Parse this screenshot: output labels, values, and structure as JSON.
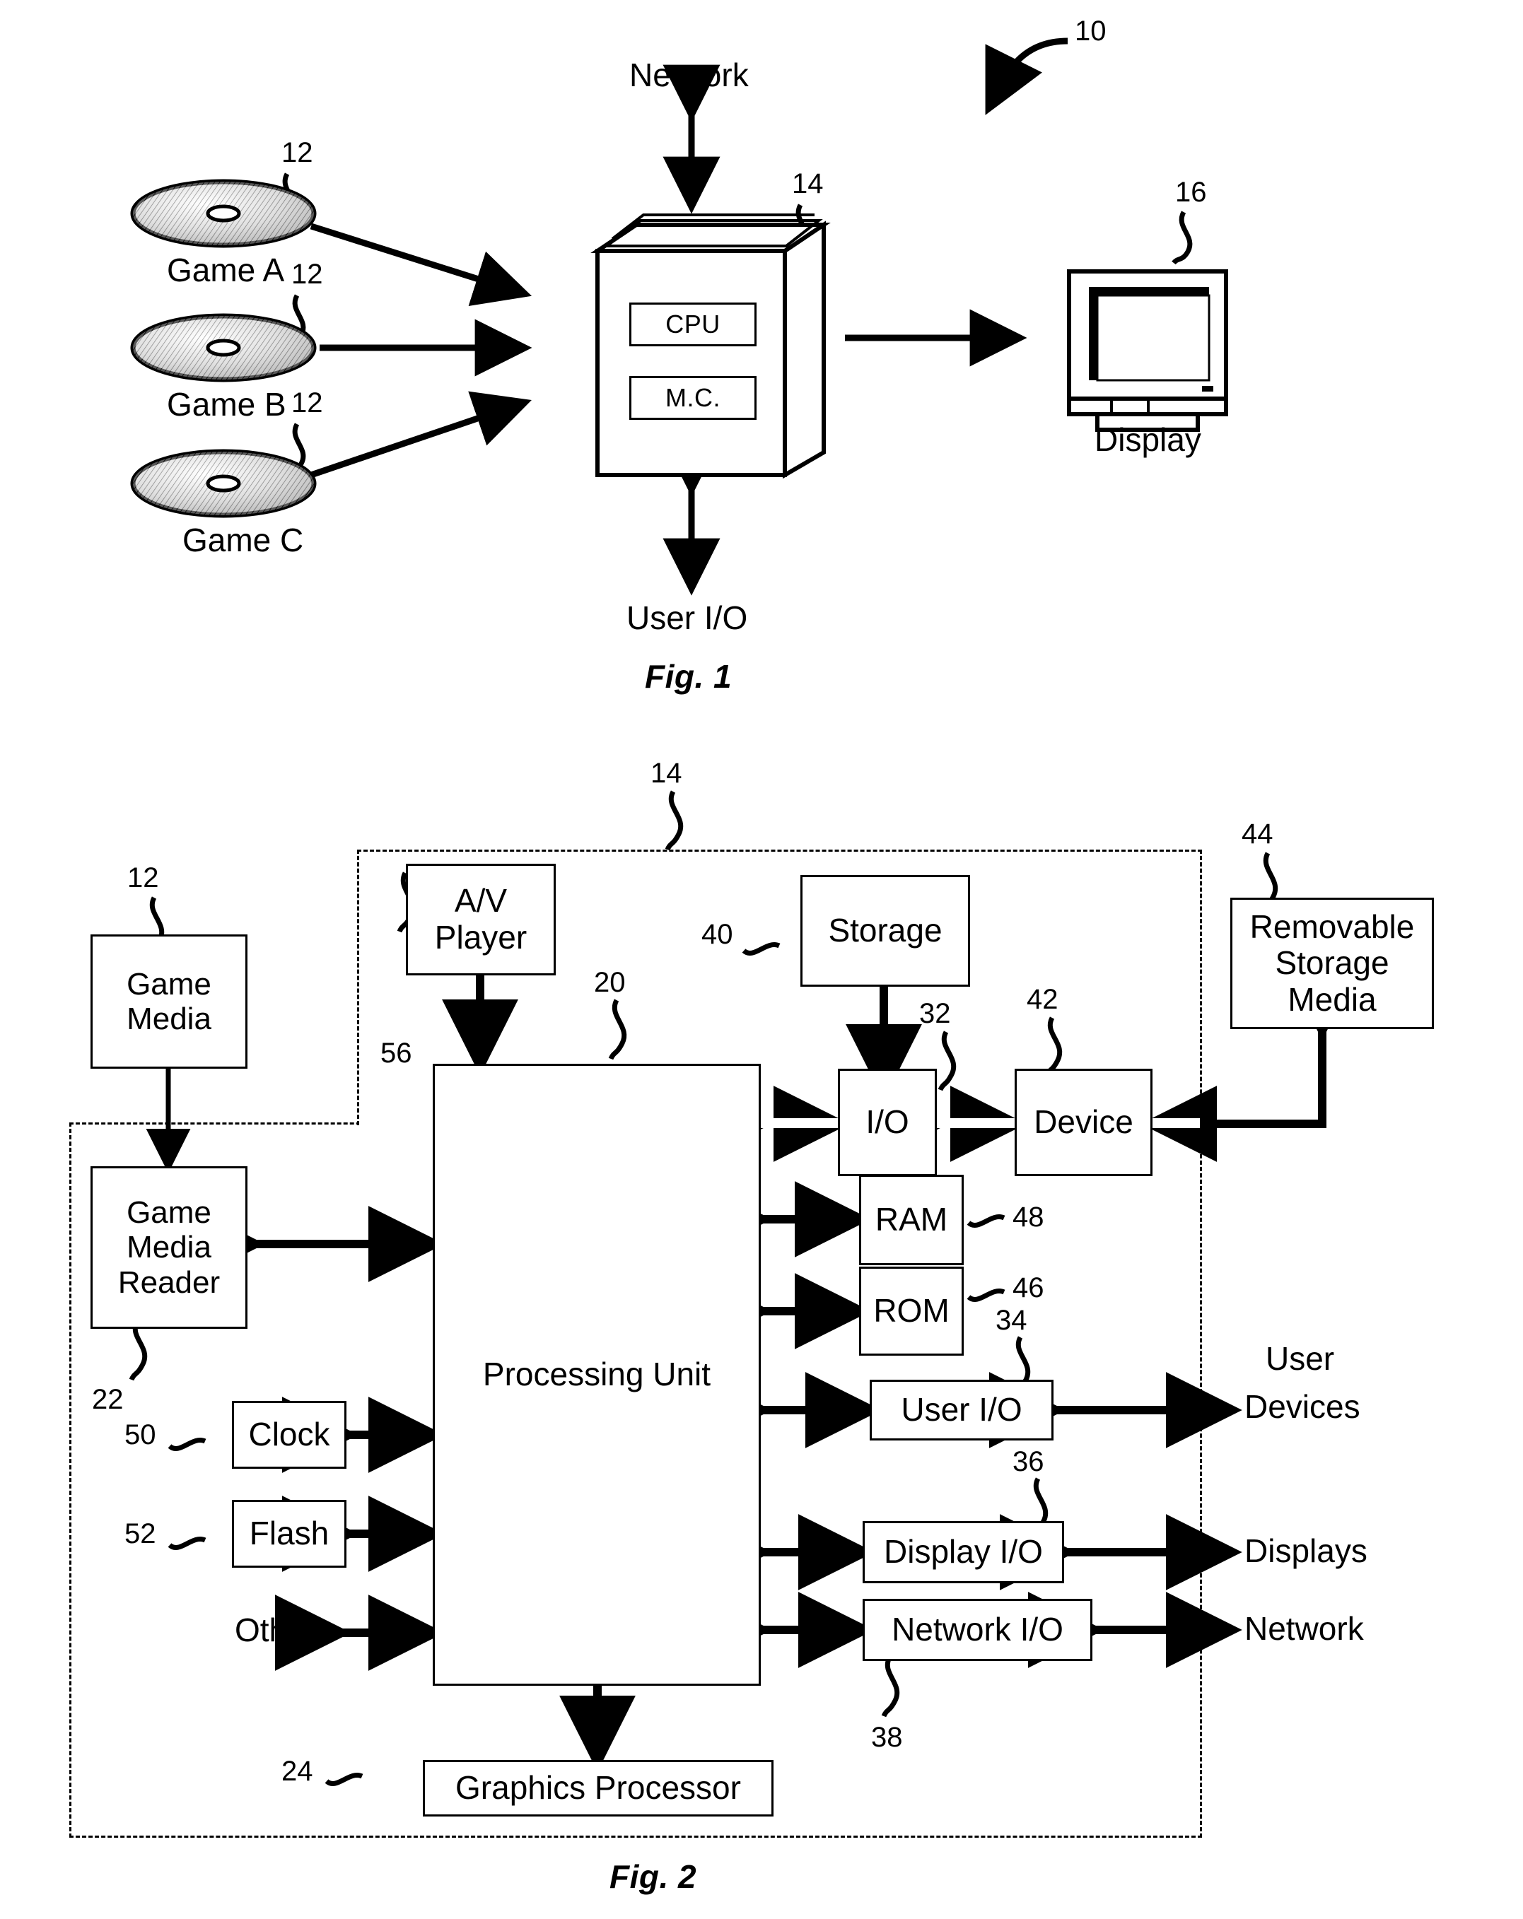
{
  "figures": [
    {
      "id": "fig1",
      "caption": "Fig. 1",
      "system_ref": "10",
      "nodes": {
        "network_top": "Network",
        "user_io_bottom": "User I/O",
        "display_label": "Display",
        "console_ref": "14",
        "display_ref": "16",
        "cpu": "CPU",
        "mc": "M.C."
      },
      "media": [
        {
          "label": "Game A",
          "ref": "12"
        },
        {
          "label": "Game B",
          "ref": "12"
        },
        {
          "label": "Game C",
          "ref": "12"
        }
      ]
    },
    {
      "id": "fig2",
      "caption": "Fig. 2",
      "console_ref": "14",
      "boxes": {
        "game_media": {
          "label": "Game\nMedia",
          "ref": "12"
        },
        "game_media_reader": {
          "label": "Game\nMedia\nReader",
          "ref": "22"
        },
        "av_player": {
          "label": "A/V\nPlayer",
          "ref": "56"
        },
        "processing_unit": {
          "label": "Processing Unit",
          "ref": "20"
        },
        "storage": {
          "label": "Storage",
          "ref": "40"
        },
        "io": {
          "label": "I/O",
          "ref": "32"
        },
        "device": {
          "label": "Device",
          "ref": "42"
        },
        "removable_storage_media": {
          "label": "Removable\nStorage\nMedia",
          "ref": "44"
        },
        "ram": {
          "label": "RAM",
          "ref": "48"
        },
        "rom": {
          "label": "ROM",
          "ref": "46"
        },
        "user_io": {
          "label": "User I/O",
          "ref": "34"
        },
        "display_io": {
          "label": "Display I/O",
          "ref": "36"
        },
        "network_io": {
          "label": "Network I/O",
          "ref": "38"
        },
        "clock": {
          "label": "Clock",
          "ref": "50"
        },
        "flash": {
          "label": "Flash",
          "ref": "52"
        },
        "graphics_processor": {
          "label": "Graphics Processor",
          "ref": "24"
        }
      },
      "plain_labels": {
        "other": "Other",
        "user_devices": "User\nDevices",
        "displays": "Displays",
        "network": "Network"
      }
    }
  ],
  "fig1": {
    "caption": "Fig. 1",
    "system_ref": "10",
    "network_label": "Network",
    "user_io_label": "User I/O",
    "display_label": "Display",
    "console_ref": "14",
    "display_ref": "16",
    "cpu_label": "CPU",
    "mc_label": "M.C.",
    "disc_a_label": "Game A",
    "disc_a_ref": "12",
    "disc_b_label": "Game B",
    "disc_b_ref": "12",
    "disc_c_label": "Game C",
    "disc_c_ref": "12"
  },
  "fig2": {
    "caption": "Fig. 2",
    "console_ref": "14",
    "game_media_label_1": "Game",
    "game_media_label_2": "Media",
    "game_media_ref": "12",
    "reader_label_1": "Game",
    "reader_label_2": "Media",
    "reader_label_3": "Reader",
    "reader_ref": "22",
    "av_label_1": "A/V",
    "av_label_2": "Player",
    "av_ref": "56",
    "pu_label": "Processing Unit",
    "pu_ref": "20",
    "storage_label": "Storage",
    "storage_ref": "40",
    "io_label": "I/O",
    "io_ref": "32",
    "device_label": "Device",
    "device_ref": "42",
    "rsm_label_1": "Removable",
    "rsm_label_2": "Storage",
    "rsm_label_3": "Media",
    "rsm_ref": "44",
    "ram_label": "RAM",
    "ram_ref": "48",
    "rom_label": "ROM",
    "rom_ref": "46",
    "user_io_label": "User I/O",
    "user_io_ref": "34",
    "display_io_label": "Display I/O",
    "display_io_ref": "36",
    "network_io_label": "Network I/O",
    "network_io_ref": "38",
    "clock_label": "Clock",
    "clock_ref": "50",
    "flash_label": "Flash",
    "flash_ref": "52",
    "other_label": "Other",
    "gp_label": "Graphics Processor",
    "gp_ref": "24",
    "user_devices_1": "User",
    "user_devices_2": "Devices",
    "displays_label": "Displays",
    "network_label": "Network"
  },
  "colors": {
    "ink": "#000000",
    "paper": "#ffffff"
  }
}
